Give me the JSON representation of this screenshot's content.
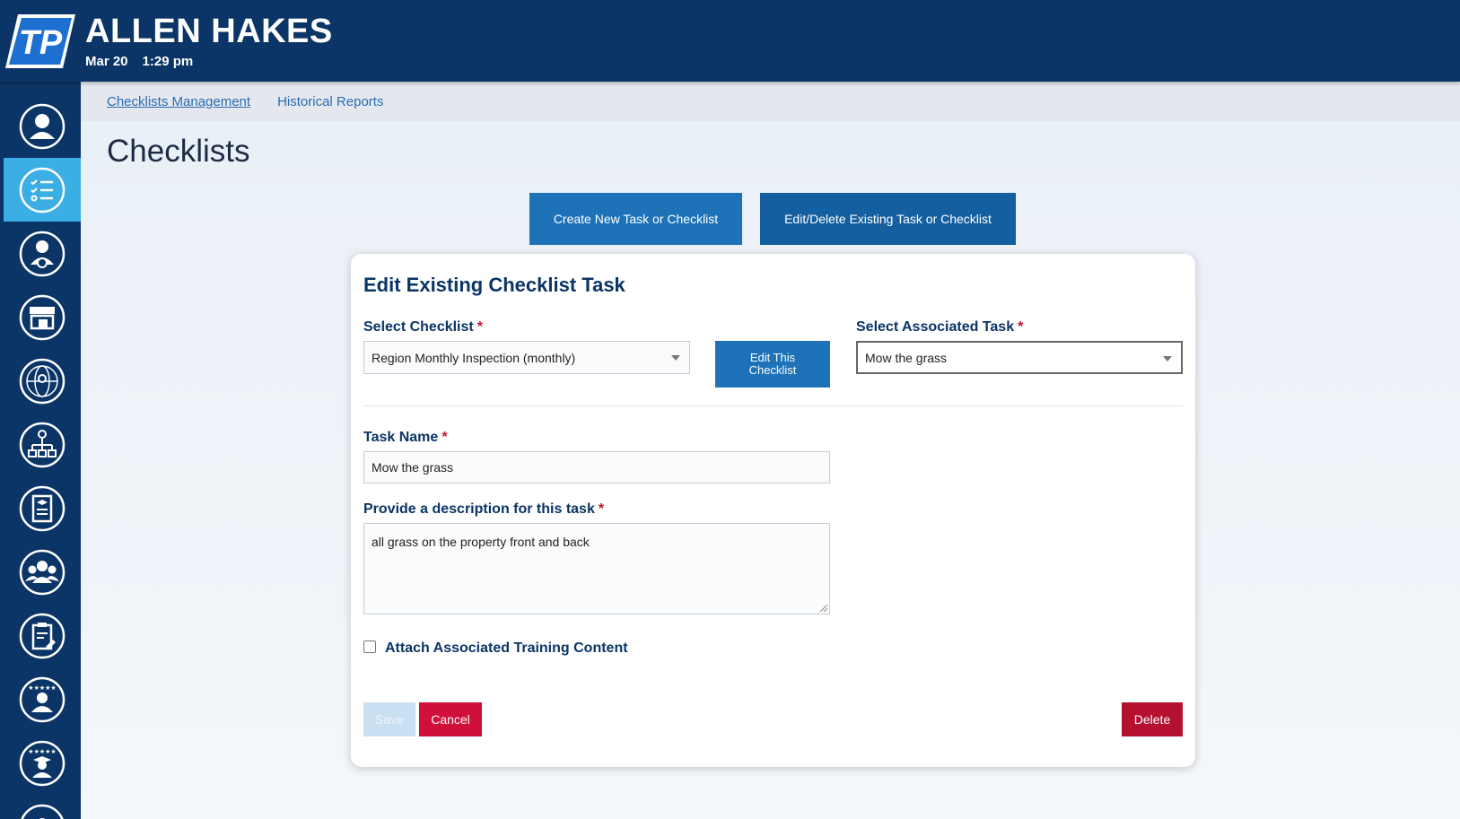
{
  "header": {
    "user_name": "ALLEN HAKES",
    "date": "Mar 20",
    "time": "1:29 pm",
    "logo_text": "TP",
    "bg_color": "#0b3566"
  },
  "sidebar": {
    "active_color": "#3aaee5",
    "items": [
      {
        "icon": "user-profile-icon",
        "active": false
      },
      {
        "icon": "checklist-icon",
        "active": true
      },
      {
        "icon": "user-settings-icon",
        "active": false
      },
      {
        "icon": "store-icon",
        "active": false
      },
      {
        "icon": "globe-location-icon",
        "active": false
      },
      {
        "icon": "org-chart-icon",
        "active": false
      },
      {
        "icon": "training-document-icon",
        "active": false
      },
      {
        "icon": "team-icon",
        "active": false
      },
      {
        "icon": "clipboard-edit-icon",
        "active": false
      },
      {
        "icon": "rated-user-icon",
        "active": false
      },
      {
        "icon": "graduate-rating-icon",
        "active": false
      },
      {
        "icon": "more-icon",
        "active": false
      }
    ]
  },
  "topnav": {
    "links": [
      "Checklists Management",
      "Historical Reports"
    ]
  },
  "page": {
    "title": "Checklists",
    "create_button": "Create New Task or Checklist",
    "edit_button": "Edit/Delete Existing Task or Checklist"
  },
  "form": {
    "title": "Edit Existing Checklist Task",
    "select_checklist_label": "Select Checklist",
    "select_checklist_value": "Region Monthly Inspection (monthly)",
    "edit_checklist_button": "Edit This Checklist",
    "select_task_label": "Select Associated Task",
    "select_task_value": "Mow the grass",
    "task_name_label": "Task Name",
    "task_name_value": "Mow the grass",
    "description_label": "Provide a description for this task",
    "description_value": "all grass on the property  front and back",
    "attach_training_label": "Attach Associated Training Content",
    "attach_training_checked": false,
    "required_mark": "*",
    "save_label": "Save",
    "cancel_label": "Cancel",
    "delete_label": "Delete"
  }
}
